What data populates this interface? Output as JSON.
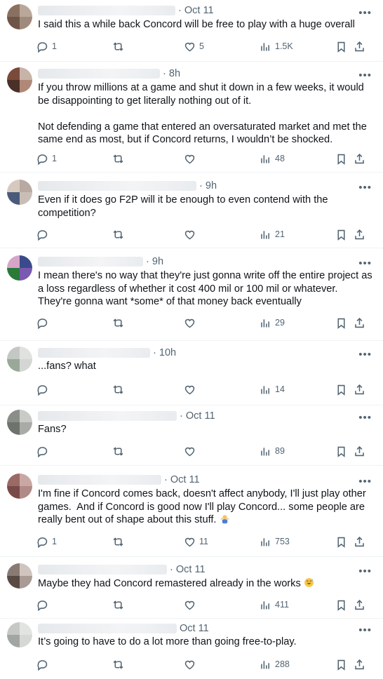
{
  "posts": [
    {
      "time": "Oct 11",
      "text": "I said this a while back Concord will be free to play with a huge overall",
      "replies": "1",
      "reposts": "",
      "likes": "5",
      "views": "1.5K",
      "av": [
        "#8a7060",
        "#b9a89a",
        "#6e5548",
        "#a08a7c"
      ]
    },
    {
      "time": "8h",
      "text": "If you throw millions at a game and shut it down in a few weeks, it would be disappointing to get literally nothing out of it.\n\nNot defending a game that entered an oversaturated market and met the same end as most, but if Concord returns, I wouldn’t be shocked.",
      "replies": "1",
      "reposts": "",
      "likes": "",
      "views": "48",
      "av": [
        "#7a4a3a",
        "#c7b3a8",
        "#4a3028",
        "#b08878"
      ]
    },
    {
      "time": "9h",
      "text": "Even if it does go F2P will it be enough to even contend with the competition?",
      "replies": "",
      "reposts": "",
      "likes": "",
      "views": "21",
      "av": [
        "#d8c9bf",
        "#b8aaa2",
        "#4a5a7a",
        "#c9beb6"
      ]
    },
    {
      "time": "9h",
      "text": "I mean there's no way that they're just gonna write off the entire project as a loss regardless of whether it cost 400 mil or 100 mil or whatever. They're gonna want *some* of that money back eventually",
      "replies": "",
      "reposts": "",
      "likes": "",
      "views": "29",
      "av": [
        "#d6a6c8",
        "#3b4a8a",
        "#2a7a3a",
        "#7a5ab0"
      ]
    },
    {
      "time": "10h",
      "text": "...fans? what",
      "replies": "",
      "reposts": "",
      "likes": "",
      "views": "14",
      "av": [
        "#c4c8c4",
        "#e0e2e0",
        "#9aa89a",
        "#d4d6d4"
      ]
    },
    {
      "time": "Oct 11",
      "text": "Fans?",
      "replies": "",
      "reposts": "",
      "likes": "",
      "views": "89",
      "av": [
        "#8a8e88",
        "#c9cbc6",
        "#6e736c",
        "#a9aca6"
      ]
    },
    {
      "time": "Oct 11",
      "text": "I'm fine if Concord comes back, doesn't affect anybody, I'll just play other games.  And if Concord is good now I'll play Concord... some people are really bent out of shape about this stuff. ",
      "emoji": "person-shrugging",
      "replies": "1",
      "reposts": "",
      "likes": "11",
      "views": "753",
      "av": [
        "#9a6a66",
        "#c9a8a4",
        "#7a4a48",
        "#b08a86"
      ]
    },
    {
      "time": "Oct 11",
      "text": "Maybe they had Concord remastered already in the works ",
      "emoji": "sweat-smile",
      "replies": "",
      "reposts": "",
      "likes": "",
      "views": "411",
      "av": [
        "#8a7a74",
        "#d0c4be",
        "#5a4a44",
        "#aa9a94"
      ]
    },
    {
      "time": "Oct 11",
      "text": "It’s going to have to do a lot more than going free-to-play.",
      "replies": "",
      "reposts": "",
      "likes": "",
      "views": "288",
      "av": [
        "#c6c8c6",
        "#e2e4e2",
        "#a2a6a2",
        "#d6d8d6"
      ]
    }
  ]
}
